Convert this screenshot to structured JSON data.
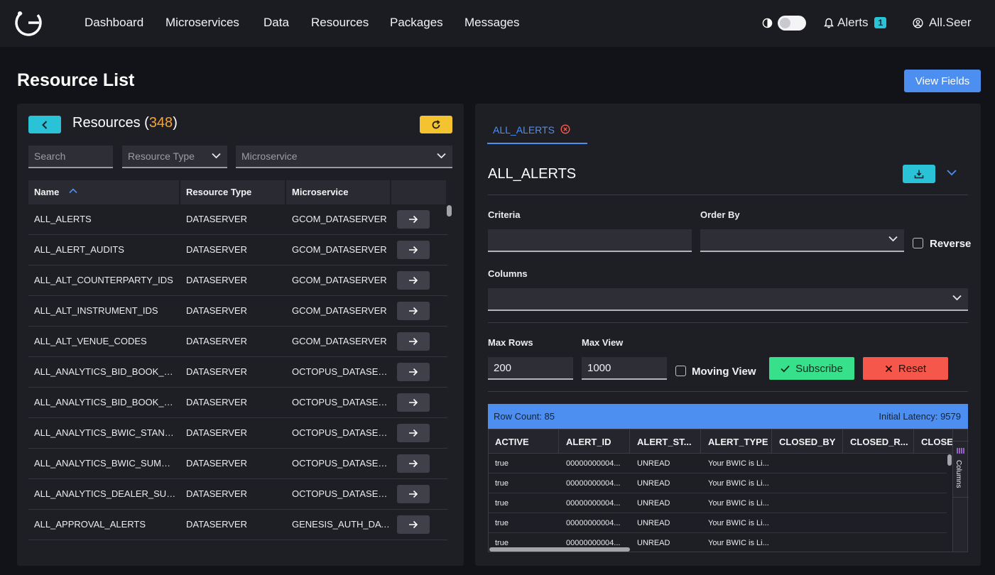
{
  "nav": {
    "items": [
      "Dashboard",
      "Microservices",
      "Data",
      "Resources",
      "Packages",
      "Messages"
    ],
    "alerts_label": "Alerts",
    "alerts_count": "1",
    "user_name": "All.Seer",
    "theme_icon": "contrast-icon"
  },
  "page": {
    "title": "Resource List",
    "view_fields_label": "View Fields"
  },
  "resources": {
    "title": "Resources (",
    "count": "348",
    "title_suffix": ")",
    "search_placeholder": "Search",
    "resource_type_placeholder": "Resource Type",
    "microservice_placeholder": "Microservice",
    "columns": [
      "Name",
      "Resource Type",
      "Microservice"
    ],
    "rows": [
      {
        "name": "ALL_ALERTS",
        "type": "DATASERVER",
        "microservice": "GCOM_DATASERVER"
      },
      {
        "name": "ALL_ALERT_AUDITS",
        "type": "DATASERVER",
        "microservice": "GCOM_DATASERVER"
      },
      {
        "name": "ALL_ALT_COUNTERPARTY_IDS",
        "type": "DATASERVER",
        "microservice": "GCOM_DATASERVER"
      },
      {
        "name": "ALL_ALT_INSTRUMENT_IDS",
        "type": "DATASERVER",
        "microservice": "GCOM_DATASERVER"
      },
      {
        "name": "ALL_ALT_VENUE_CODES",
        "type": "DATASERVER",
        "microservice": "GCOM_DATASERVER"
      },
      {
        "name": "ALL_ANALYTICS_BID_BOOK_ST...",
        "type": "DATASERVER",
        "microservice": "OCTOPUS_DATASER..."
      },
      {
        "name": "ALL_ANALYTICS_BID_BOOK_SU...",
        "type": "DATASERVER",
        "microservice": "OCTOPUS_DATASER..."
      },
      {
        "name": "ALL_ANALYTICS_BWIC_STANDA...",
        "type": "DATASERVER",
        "microservice": "OCTOPUS_DATASER..."
      },
      {
        "name": "ALL_ANALYTICS_BWIC_SUMMA...",
        "type": "DATASERVER",
        "microservice": "OCTOPUS_DATASER..."
      },
      {
        "name": "ALL_ANALYTICS_DEALER_SUM...",
        "type": "DATASERVER",
        "microservice": "OCTOPUS_DATASER..."
      },
      {
        "name": "ALL_APPROVAL_ALERTS",
        "type": "DATASERVER",
        "microservice": "GENESIS_AUTH_DAT..."
      }
    ]
  },
  "detail": {
    "tab_label": "ALL_ALERTS",
    "title": "ALL_ALERTS",
    "criteria_label": "Criteria",
    "criteria_value": "",
    "order_by_label": "Order By",
    "order_by_value": "",
    "reverse_label": "Reverse",
    "columns_label": "Columns",
    "max_rows_label": "Max Rows",
    "max_rows_value": "200",
    "max_view_label": "Max View",
    "max_view_value": "1000",
    "moving_view_label": "Moving View",
    "subscribe_label": "Subscribe",
    "reset_label": "Reset",
    "row_count": "Row Count: 85",
    "initial_latency": "Initial Latency: 9579",
    "grid_columns": [
      "ACTIVE",
      "ALERT_ID",
      "ALERT_ST...",
      "ALERT_TYPE",
      "CLOSED_BY",
      "CLOSED_R...",
      "CLOSED_"
    ],
    "grid_rows": [
      {
        "active": "true",
        "alert_id": "00000000004...",
        "alert_status": "UNREAD",
        "alert_type": "Your BWIC is Li..."
      },
      {
        "active": "true",
        "alert_id": "00000000004...",
        "alert_status": "UNREAD",
        "alert_type": "Your BWIC is Li..."
      },
      {
        "active": "true",
        "alert_id": "00000000004...",
        "alert_status": "UNREAD",
        "alert_type": "Your BWIC is Li..."
      },
      {
        "active": "true",
        "alert_id": "00000000004...",
        "alert_status": "UNREAD",
        "alert_type": "Your BWIC is Li..."
      },
      {
        "active": "true",
        "alert_id": "00000000004...",
        "alert_status": "UNREAD",
        "alert_type": "Your BWIC is Li..."
      }
    ],
    "columns_side_label": "Columns"
  },
  "colors": {
    "accent_blue": "#4d8ff1",
    "accent_cyan": "#29c2d6",
    "accent_yellow": "#f4c330",
    "count_orange": "#f3a43a",
    "subscribe_green": "#37e08a",
    "reset_red": "#f5584a"
  }
}
